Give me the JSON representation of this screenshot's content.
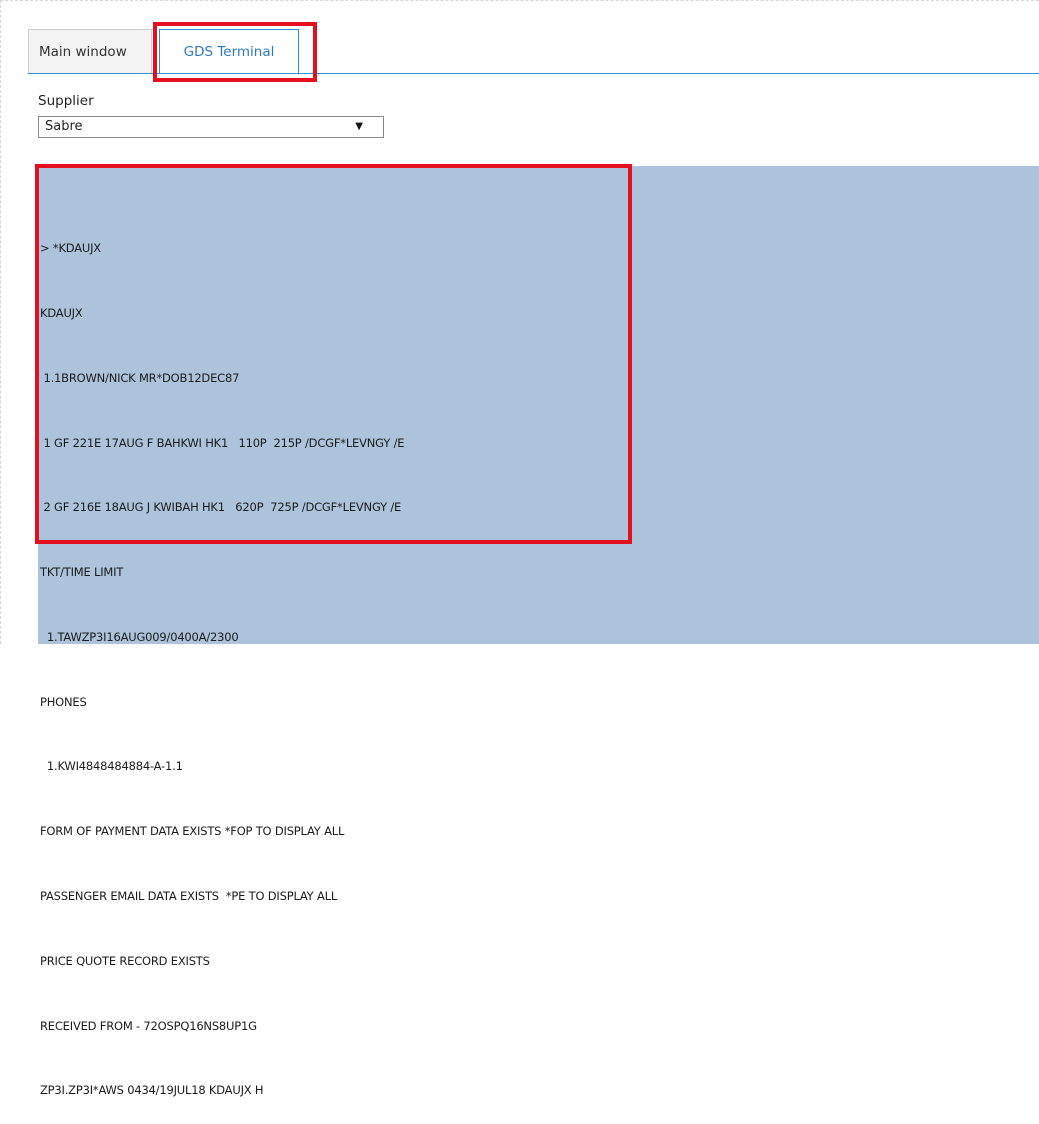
{
  "tabs": [
    {
      "label": "Main window"
    },
    {
      "label": "GDS Terminal",
      "active": true
    }
  ],
  "supplier": {
    "label": "Supplier",
    "selected": "Sabre"
  },
  "terminal": {
    "lines": [
      "> *KDAUJX",
      "KDAUJX",
      " 1.1BROWN/NICK MR*DOB12DEC87",
      " 1 GF 221E 17AUG F BAHKWI HK1   110P  215P /DCGF*LEVNGY /E",
      " 2 GF 216E 18AUG J KWIBAH HK1   620P  725P /DCGF*LEVNGY /E",
      "TKT/TIME LIMIT",
      "  1.TAWZP3I16AUG009/0400A/2300",
      "PHONES",
      "  1.KWI4848484884-A-1.1",
      "FORM OF PAYMENT DATA EXISTS *FOP TO DISPLAY ALL",
      "PASSENGER EMAIL DATA EXISTS  *PE TO DISPLAY ALL",
      "PRICE QUOTE RECORD EXISTS",
      "RECEIVED FROM - 72OSPQ16NS8UP1G",
      "ZP3I.ZP3I*AWS 0434/19JUL18 KDAUJX H"
    ]
  },
  "colors": {
    "accent": "#2b91d4",
    "highlight": "#e3101f",
    "terminal_bg": "#adc3dc"
  }
}
